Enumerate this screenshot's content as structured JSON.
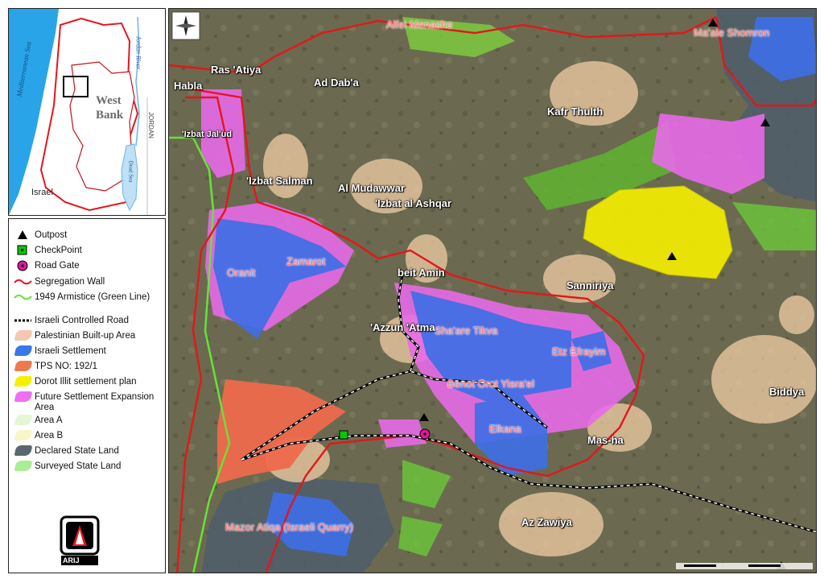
{
  "inset": {
    "sea_label": "Mediterranean Sea",
    "jordan_river_label": "Jordan River",
    "dead_sea_label": "Dead Sea",
    "west_bank_label_1": "West",
    "west_bank_label_2": "Bank",
    "israel_label": "Israel",
    "jordan_label": "JORDAN"
  },
  "legend": {
    "items": [
      {
        "label": "Outpost",
        "icon": "triangle-icon",
        "color": "#000000"
      },
      {
        "label": "CheckPoint",
        "icon": "checkpoint-icon",
        "color": "#00cc00"
      },
      {
        "label": "Road Gate",
        "icon": "road-gate-icon",
        "color": "#e0179c"
      },
      {
        "label": "Segregation Wall",
        "icon": "wall-line-icon",
        "color": "#e4161b"
      },
      {
        "label": "1949 Armistice (Green Line)",
        "icon": "green-line-icon",
        "color": "#66e33a"
      },
      {
        "label": "Israeli Controlled Road",
        "icon": "road-line-icon",
        "color": "#000000"
      },
      {
        "label": "Palestinian Built-up Area",
        "icon": "swatch",
        "color": "#f4c8b0"
      },
      {
        "label": "Israeli Settlement",
        "icon": "swatch",
        "color": "#3a78e8"
      },
      {
        "label": "TPS NO: 192/1",
        "icon": "swatch",
        "color": "#ee7a50"
      },
      {
        "label": "Dorot Illit settlement plan",
        "icon": "swatch",
        "color": "#f6f000"
      },
      {
        "label": "Future Settlement Expansion Area",
        "icon": "swatch",
        "color": "#f06ff0"
      },
      {
        "label": "Area A",
        "icon": "swatch",
        "color": "#e2f7d2"
      },
      {
        "label": "Area B",
        "icon": "swatch",
        "color": "#f8f6c8"
      },
      {
        "label": "Declared State Land",
        "icon": "swatch",
        "color": "#5a6670"
      },
      {
        "label": "Surveyed State Land",
        "icon": "swatch",
        "color": "#a9ee95"
      }
    ],
    "logo_text": "ARIJ"
  },
  "map": {
    "labels": [
      {
        "text": "Alfei Menashe",
        "style": "pink"
      },
      {
        "text": "Ma'ale Shomron",
        "style": "pink"
      },
      {
        "text": "Ras 'Atiya",
        "style": "white"
      },
      {
        "text": "Habla",
        "style": "white"
      },
      {
        "text": "Ad Dab'a",
        "style": "white"
      },
      {
        "text": "Kafr Thulth",
        "style": "white"
      },
      {
        "text": "'Izbat Jal'ud",
        "style": "white"
      },
      {
        "text": "'Izbat Salman",
        "style": "white"
      },
      {
        "text": "Al Mudawwar",
        "style": "white"
      },
      {
        "text": "'Izbat al Ashqar",
        "style": "white"
      },
      {
        "text": "Oranit",
        "style": "pink"
      },
      {
        "text": "Zamarot",
        "style": "pink"
      },
      {
        "text": "beit Amin",
        "style": "white"
      },
      {
        "text": "Sanniriya",
        "style": "white"
      },
      {
        "text": "'Azzun 'Atma",
        "style": "white"
      },
      {
        "text": "Sha'are Tikva",
        "style": "pink"
      },
      {
        "text": "Etz Efrayim",
        "style": "pink"
      },
      {
        "text": "Biddya",
        "style": "white"
      },
      {
        "text": "Benot Orot Yisra'el",
        "style": "pink"
      },
      {
        "text": "Elkana",
        "style": "pink"
      },
      {
        "text": "Mas-ha",
        "style": "white"
      },
      {
        "text": "Mazor Atiqa (Israeli Quarry)",
        "style": "pink"
      },
      {
        "text": "Az Zawiya",
        "style": "white"
      }
    ]
  }
}
